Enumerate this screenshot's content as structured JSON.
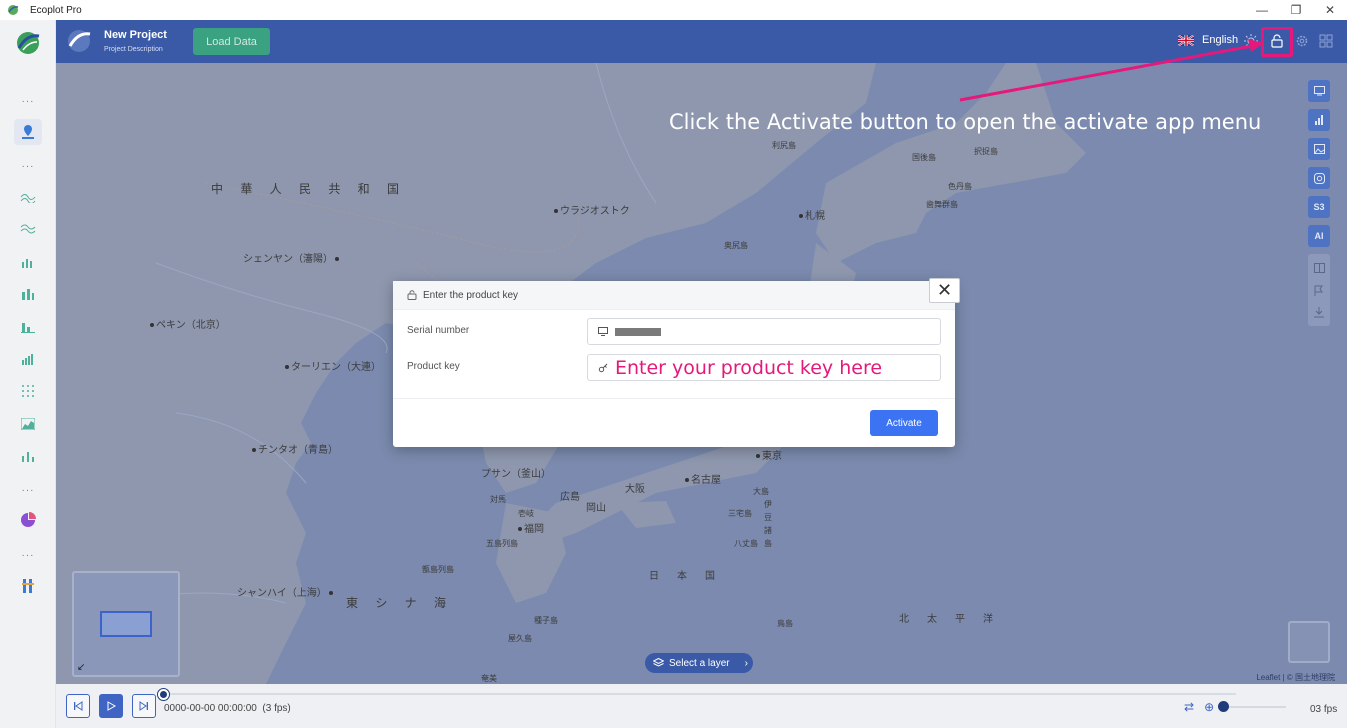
{
  "window": {
    "title": "Ecoplot Pro",
    "minimize": "—",
    "restore": "❐",
    "close": "✕"
  },
  "header": {
    "project_name": "New Project",
    "project_description": "Project Description",
    "load_data_label": "Load Data",
    "language": "English"
  },
  "rail": {
    "dots": "···"
  },
  "map": {
    "places": {
      "china": "中 華 人 民 共 和 国",
      "vladivostok": "ウラジオストク",
      "shenyang": "シェンヤン（瀋陽）",
      "beijing": "ペキン（北京）",
      "dalian": "ターリエン（大連）",
      "qingdao": "チンタオ（青島）",
      "busan": "プサン（釜山）",
      "shanghai": "シャンハイ（上海）",
      "east_china_sea": "東 シ ナ 海",
      "japan": "日　本　国",
      "pacific": "北　太　平　洋",
      "sapporo": "札幌",
      "nagoya": "名古屋",
      "tokyo": "東京",
      "osaka": "大阪",
      "hiroshima": "広島",
      "fukuoka": "福岡",
      "okayama": "岡山",
      "rishiri": "利尻島",
      "kunashiri": "国後島",
      "etorofu": "択捉島",
      "shikotan": "色丹島",
      "habomai": "歯舞群島",
      "okushiri": "奥尻島",
      "tsushima": "対馬",
      "iki": "壱岐",
      "goto": "五島列島",
      "koshiki": "甑島列島",
      "tanegashima": "種子島",
      "yakushima": "屋久島",
      "amami": "奄美",
      "oshima": "大島",
      "miyake": "三宅島",
      "hachijo": "八丈島",
      "izu": "伊豆諸島",
      "torishima": "鳥島"
    },
    "tools": [
      "S3",
      "AI"
    ],
    "layer_select_label": "Select a layer",
    "attribution": "Leaflet | © 国土地理院"
  },
  "timeline": {
    "time": "0000-00-00 00:00:00",
    "fps_note": "(3 fps)",
    "fps_value": "03 fps"
  },
  "modal": {
    "title": "Enter the product key",
    "serial_label": "Serial number",
    "product_key_label": "Product key",
    "product_key_placeholder": "Enter your product key here",
    "activate_label": "Activate",
    "close_glyph": "✕"
  },
  "annotation": {
    "text": "Click the Activate button to open the activate app menu"
  },
  "colors": {
    "header": "#3a5aa8",
    "load_button": "#3aa281",
    "activate_button": "#3b73f2",
    "annotation": "#e5197b",
    "map_overlay": "#7f8db2"
  }
}
